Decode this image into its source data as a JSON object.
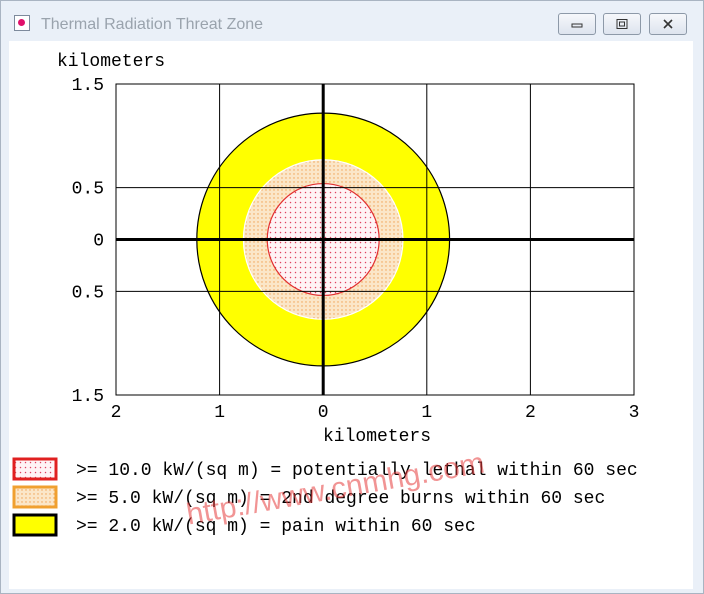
{
  "window": {
    "title": "Thermal Radiation Threat Zone",
    "icon": "app-icon",
    "controls": [
      "minimize-icon",
      "maximize-icon",
      "close-icon"
    ]
  },
  "chart_data": {
    "type": "scatter",
    "ylabel": "kilometers",
    "xlabel": "kilometers",
    "x_ticks": [
      {
        "value": -2,
        "label": "2"
      },
      {
        "value": -1,
        "label": "1"
      },
      {
        "value": 0,
        "label": "0"
      },
      {
        "value": 1,
        "label": "1"
      },
      {
        "value": 2,
        "label": "2"
      },
      {
        "value": 3,
        "label": "3"
      }
    ],
    "y_ticks": [
      {
        "value": 1.5,
        "label": "1.5"
      },
      {
        "value": 0.5,
        "label": "0.5"
      },
      {
        "value": 0,
        "label": "0"
      },
      {
        "value": -0.5,
        "label": "0.5"
      },
      {
        "value": -1.5,
        "label": "1.5"
      }
    ],
    "xlim": [
      -2,
      3
    ],
    "ylim": [
      -1.5,
      1.5
    ],
    "grid": true,
    "zones": [
      {
        "radius_km": 1.22,
        "fill": "#ffff00",
        "stroke": "#000000"
      },
      {
        "radius_km": 0.77,
        "fill": "#fbe6c8",
        "stroke": "#ffffff",
        "pattern": "dots-orange"
      },
      {
        "radius_km": 0.54,
        "fill": "#fff3f5",
        "stroke": "#e23030",
        "pattern": "dots-red"
      }
    ]
  },
  "legend": [
    {
      "swatch_fill": "#fbe0e6",
      "swatch_border": "#e02020",
      "label": ">= 10.0 kW/(sq m) = potentially lethal within 60 sec"
    },
    {
      "swatch_fill": "#fbe0c0",
      "swatch_border": "#f0a030",
      "label": ">= 5.0 kW/(sq m) = 2nd degree burns within 60 sec"
    },
    {
      "swatch_fill": "#ffff00",
      "swatch_border": "#000000",
      "label": ">= 2.0 kW/(sq m) = pain within 60 sec"
    }
  ],
  "watermark": "http://www.cnmhg.com"
}
